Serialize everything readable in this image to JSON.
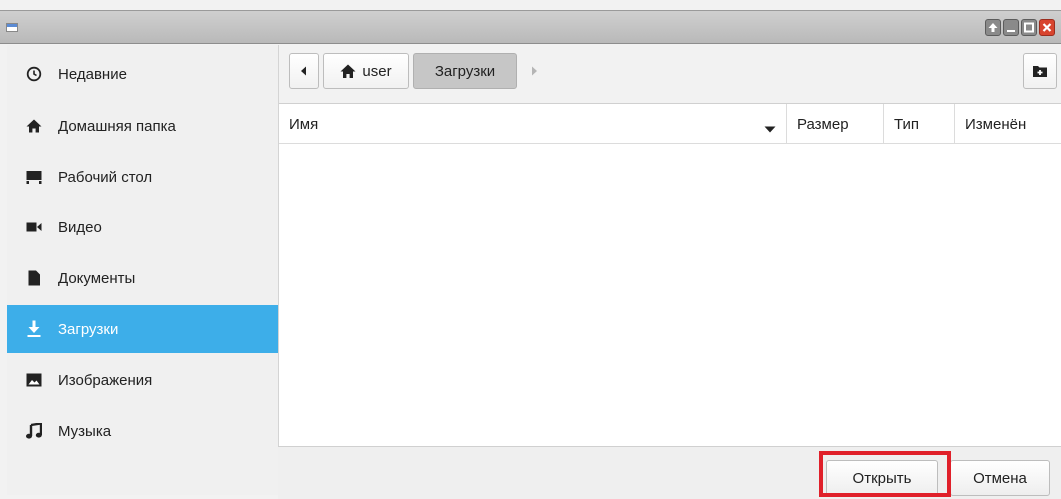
{
  "window": {
    "title": "",
    "controls": [
      "arrow-up-icon",
      "minimize-icon",
      "maximize-icon",
      "close-icon"
    ]
  },
  "sidebar": {
    "items": [
      {
        "label": "Недавние",
        "icon": "clock-icon",
        "active": false
      },
      {
        "label": "Домашняя папка",
        "icon": "home-icon",
        "active": false
      },
      {
        "label": "Рабочий стол",
        "icon": "desktop-icon",
        "active": false
      },
      {
        "label": "Видео",
        "icon": "video-icon",
        "active": false
      },
      {
        "label": "Документы",
        "icon": "document-icon",
        "active": false
      },
      {
        "label": "Загрузки",
        "icon": "download-icon",
        "active": true
      },
      {
        "label": "Изображения",
        "icon": "image-icon",
        "active": false
      },
      {
        "label": "Музыка",
        "icon": "music-icon",
        "active": false
      }
    ]
  },
  "pathbar": {
    "segments": [
      "user",
      "Загрузки"
    ],
    "current": "Загрузки"
  },
  "columns": {
    "name": "Имя",
    "size": "Размер",
    "type": "Тип",
    "modified": "Изменён",
    "sort_column": "name",
    "sort_direction": "descending"
  },
  "files": [],
  "buttons": {
    "open": "Открыть",
    "cancel": "Отмена"
  },
  "colors": {
    "accent": "#3daee9",
    "highlight_border": "#e0202a"
  }
}
